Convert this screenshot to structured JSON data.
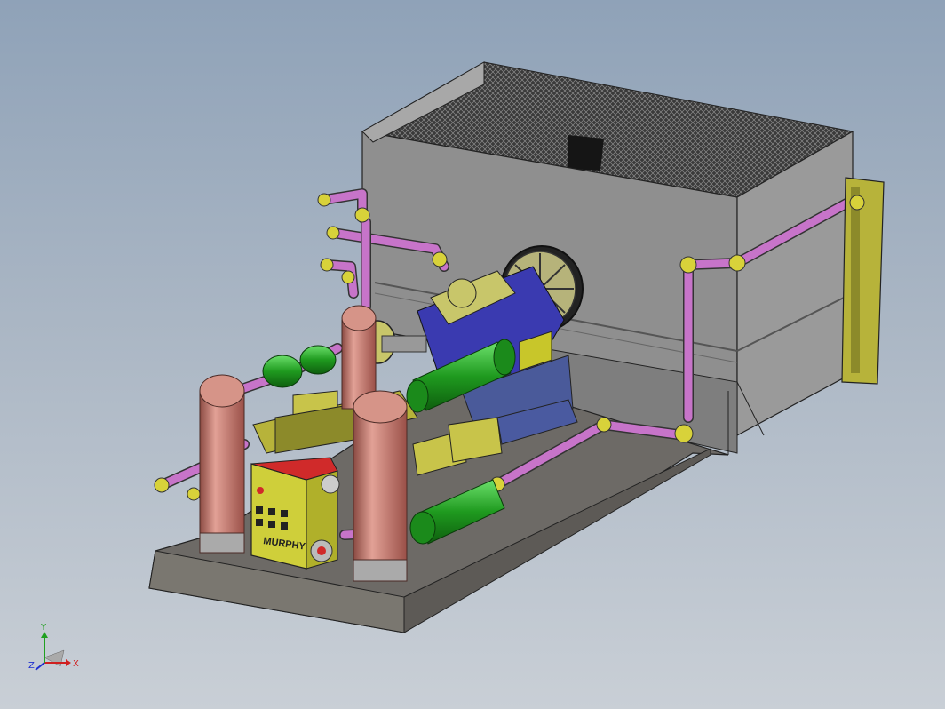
{
  "viewport": {
    "background_top": "#8fa2b8",
    "background_bottom": "#c9cfd6"
  },
  "model": {
    "panel_brand": "MURPHY",
    "colors": {
      "enclosure": "#8f8f8f",
      "skid": "#6d6a66",
      "pipe": "#c774c9",
      "fitting": "#d8d23a",
      "vessel": "#c97a6e",
      "cooler": "#26a326",
      "control_panel": "#cfcf3a",
      "panel_header": "#d02a2a",
      "engine_block": "#3a3ab0"
    }
  },
  "triad": {
    "x_label": "X",
    "y_label": "Y",
    "z_label": "Z",
    "x_color": "#d02020",
    "y_color": "#20a020",
    "z_color": "#2030d0"
  }
}
